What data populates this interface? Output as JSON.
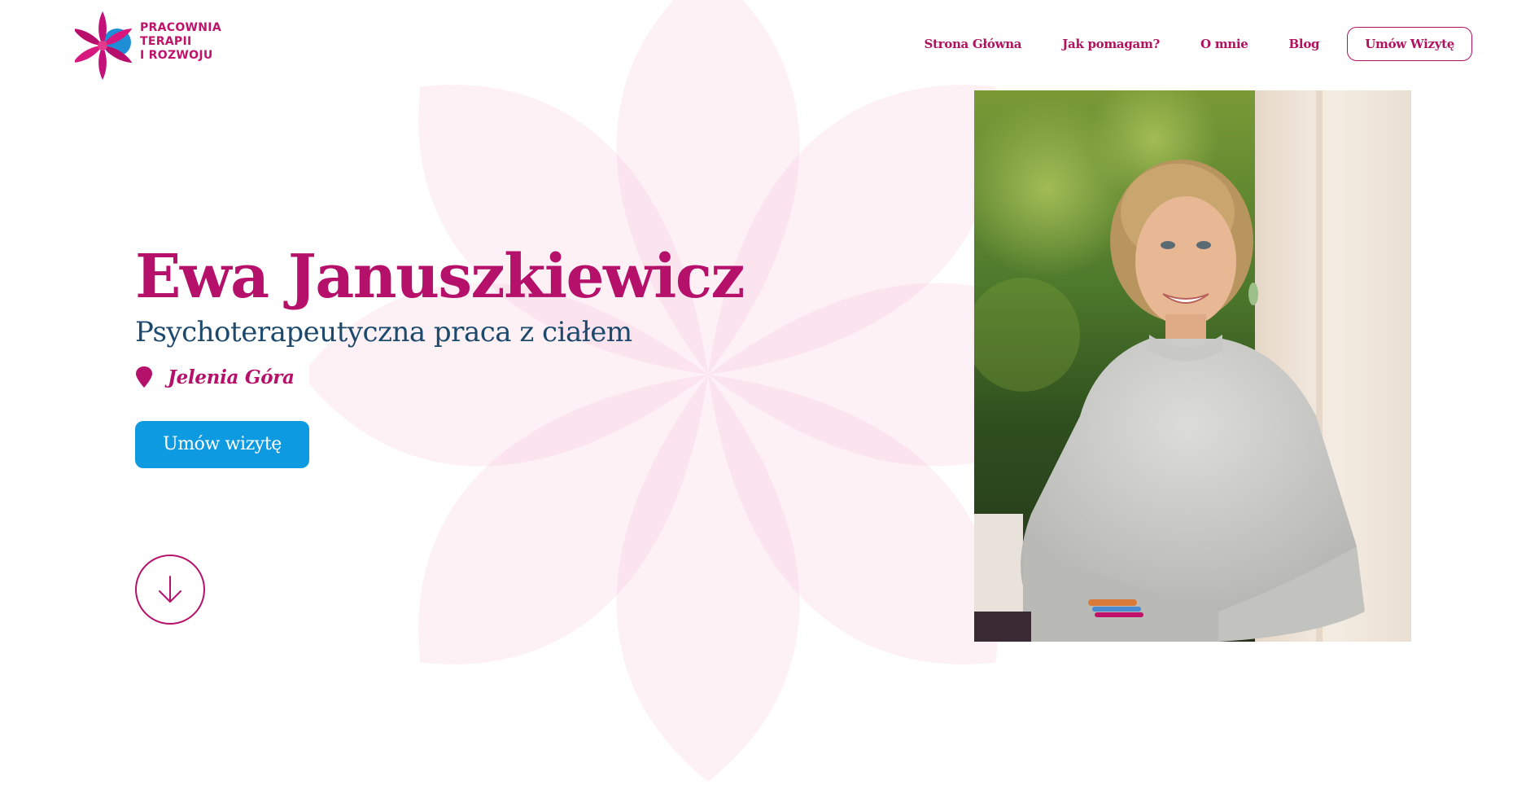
{
  "colors": {
    "brand_magenta": "#b5106a",
    "nav_magenta": "#b0125f",
    "subtitle_navy": "#1d4a6c",
    "button_blue": "#0d9ae0",
    "flower_pink": "#f3cbe0"
  },
  "logo": {
    "lines": [
      "PRACOWNIA",
      "TERAPII",
      "I ROZWOJU"
    ],
    "icon": "lotus-flower-icon"
  },
  "nav": {
    "items": [
      {
        "label": "Strona Główna"
      },
      {
        "label": "Jak pomagam?"
      },
      {
        "label": "O mnie"
      },
      {
        "label": "Blog"
      }
    ],
    "cta_label": "Umów Wizytę"
  },
  "hero": {
    "name": "Ewa Januszkiewicz",
    "subtitle": "Psychoterapeutyczna praca z ciałem",
    "location": "Jelenia Góra",
    "location_icon": "map-pin-icon",
    "button_label": "Umów wizytę",
    "scroll_icon": "arrow-down-icon"
  },
  "portrait": {
    "alt": "portrait-photo"
  }
}
